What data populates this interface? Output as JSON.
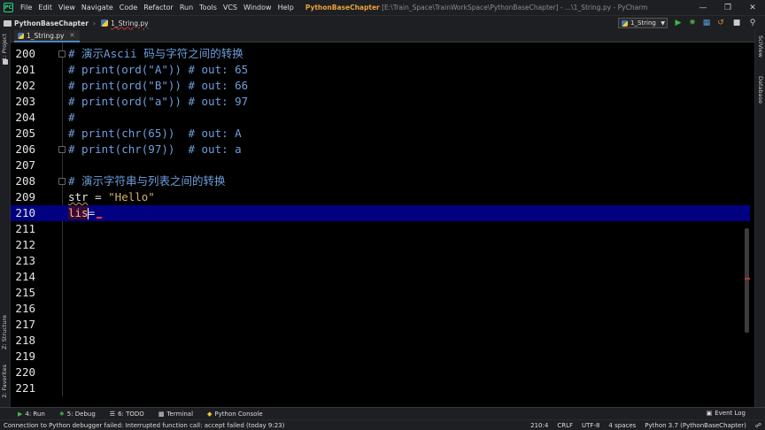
{
  "menubar": {
    "items": [
      "File",
      "Edit",
      "View",
      "Navigate",
      "Code",
      "Refactor",
      "Run",
      "Tools",
      "VCS",
      "Window",
      "Help"
    ],
    "project_name": "PythonBaseChapter",
    "title_rest": " [E:\\Train_Space\\TrainWorkSpace\\PythonBaseChapter] - ...\\1_String.py - PyCharm"
  },
  "navbar": {
    "project": "PythonBaseChapter",
    "file": "1_String.py",
    "run_config": "1_String"
  },
  "left_strip": {
    "project_tab": "1: Project",
    "structure_tab": "Z: Structure",
    "favorites_tab": "2: Favorites"
  },
  "right_strip": {
    "sciview_tab": "SciView",
    "database_tab": "Database"
  },
  "editor_tab": {
    "label": "1_String.py"
  },
  "editor": {
    "lines": [
      {
        "num": "200",
        "text": "# 演示Ascii 码与字符之间的转换",
        "kind": "comment",
        "fold": true
      },
      {
        "num": "201",
        "text": "# print(ord(\"A\")) # out: 65",
        "kind": "comment"
      },
      {
        "num": "202",
        "text": "# print(ord(\"B\")) # out: 66",
        "kind": "comment"
      },
      {
        "num": "203",
        "text": "# print(ord(\"a\")) # out: 97",
        "kind": "comment"
      },
      {
        "num": "204",
        "text": "#",
        "kind": "comment"
      },
      {
        "num": "205",
        "text": "# print(chr(65))  # out: A",
        "kind": "comment"
      },
      {
        "num": "206",
        "text": "# print(chr(97))  # out: a",
        "kind": "comment",
        "fold": true
      },
      {
        "num": "207",
        "text": "",
        "kind": "plain"
      },
      {
        "num": "208",
        "text": "# 演示字符串与列表之间的转换",
        "kind": "comment",
        "fold": true
      },
      {
        "num": "209",
        "text": "",
        "kind": "assign"
      },
      {
        "num": "210",
        "text": "",
        "kind": "current"
      },
      {
        "num": "211",
        "text": "",
        "kind": "plain"
      },
      {
        "num": "212",
        "text": "",
        "kind": "plain"
      },
      {
        "num": "213",
        "text": "",
        "kind": "plain"
      },
      {
        "num": "214",
        "text": "",
        "kind": "plain"
      },
      {
        "num": "215",
        "text": "",
        "kind": "plain"
      },
      {
        "num": "216",
        "text": "",
        "kind": "plain"
      },
      {
        "num": "217",
        "text": "",
        "kind": "plain"
      },
      {
        "num": "218",
        "text": "",
        "kind": "plain"
      },
      {
        "num": "219",
        "text": "",
        "kind": "plain"
      },
      {
        "num": "220",
        "text": "",
        "kind": "plain"
      },
      {
        "num": "221",
        "text": "",
        "kind": "plain"
      }
    ],
    "line209": {
      "var": "str",
      "op": " = ",
      "value": "\"Hello\""
    },
    "line210": {
      "typed": "lis",
      "op": "="
    }
  },
  "toolwindows": {
    "run": "4: Run",
    "debug": "5: Debug",
    "todo": "6: TODO",
    "terminal": "Terminal",
    "python_console": "Python Console",
    "event_log": "Event Log"
  },
  "status": {
    "message": "Connection to Python debugger failed: Interrupted function call: accept failed (today 9:23)",
    "position": "210:4",
    "line_sep": "CRLF",
    "encoding": "UTF-8",
    "indent": "4 spaces",
    "interpreter": "Python 3.7 (PythonBaseChapter)"
  },
  "colors": {
    "current_line": "#000080",
    "comment": "#6e9fdc",
    "string": "#d4b070",
    "accent": "#e8a33d"
  }
}
